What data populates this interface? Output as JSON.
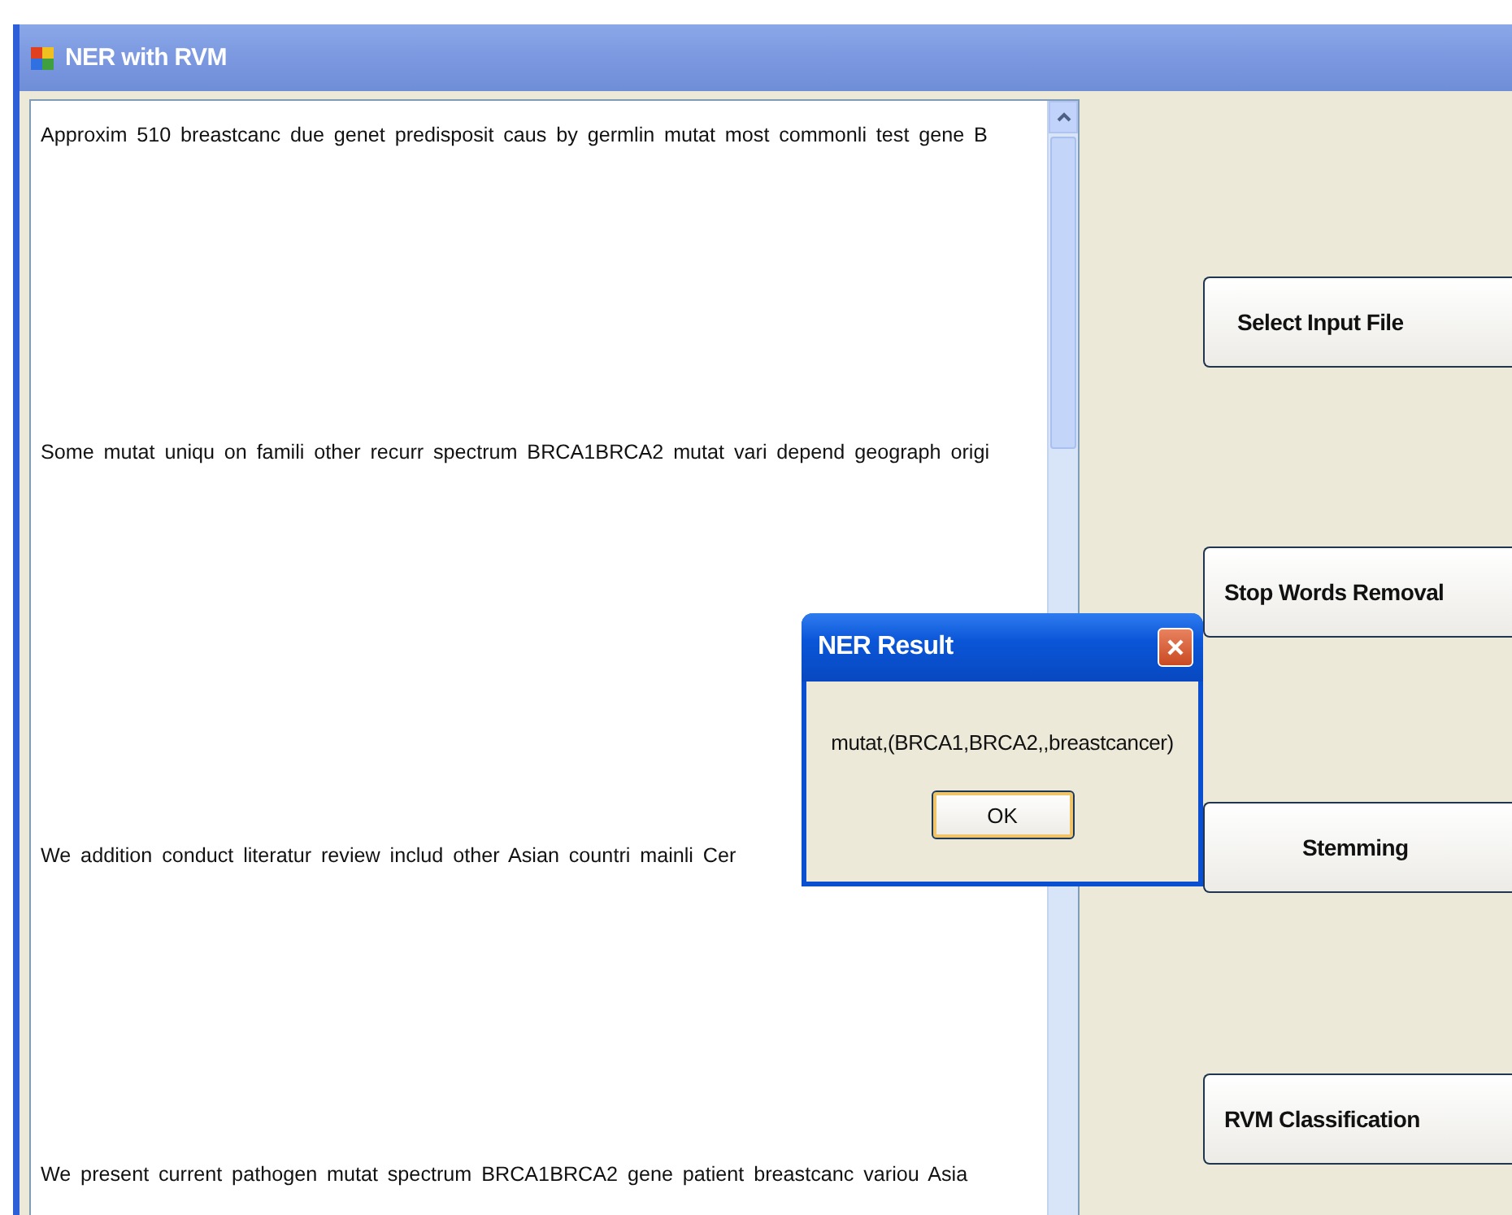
{
  "window": {
    "title": "NER with RVM"
  },
  "text_area": {
    "lines": [
      "Approxim 510 breastcanc due genet predisposit caus by germlin mutat most commonli test gene B",
      "Some mutat uniqu on famili other recurr spectrum BRCA1BRCA2 mutat vari depend geograph origi",
      "We addition conduct literatur review includ other Asian countri mainli Cer",
      "We present current pathogen mutat spectrum BRCA1BRCA2 gene patient breastcanc variou Asia"
    ]
  },
  "buttons": [
    "Select Input File",
    "Stop Words Removal",
    "Stemming",
    "RVM Classification"
  ],
  "dialog": {
    "title": "NER Result",
    "message": "mutat,(BRCA1,BRCA2,,breastcancer)",
    "button": "OK"
  }
}
